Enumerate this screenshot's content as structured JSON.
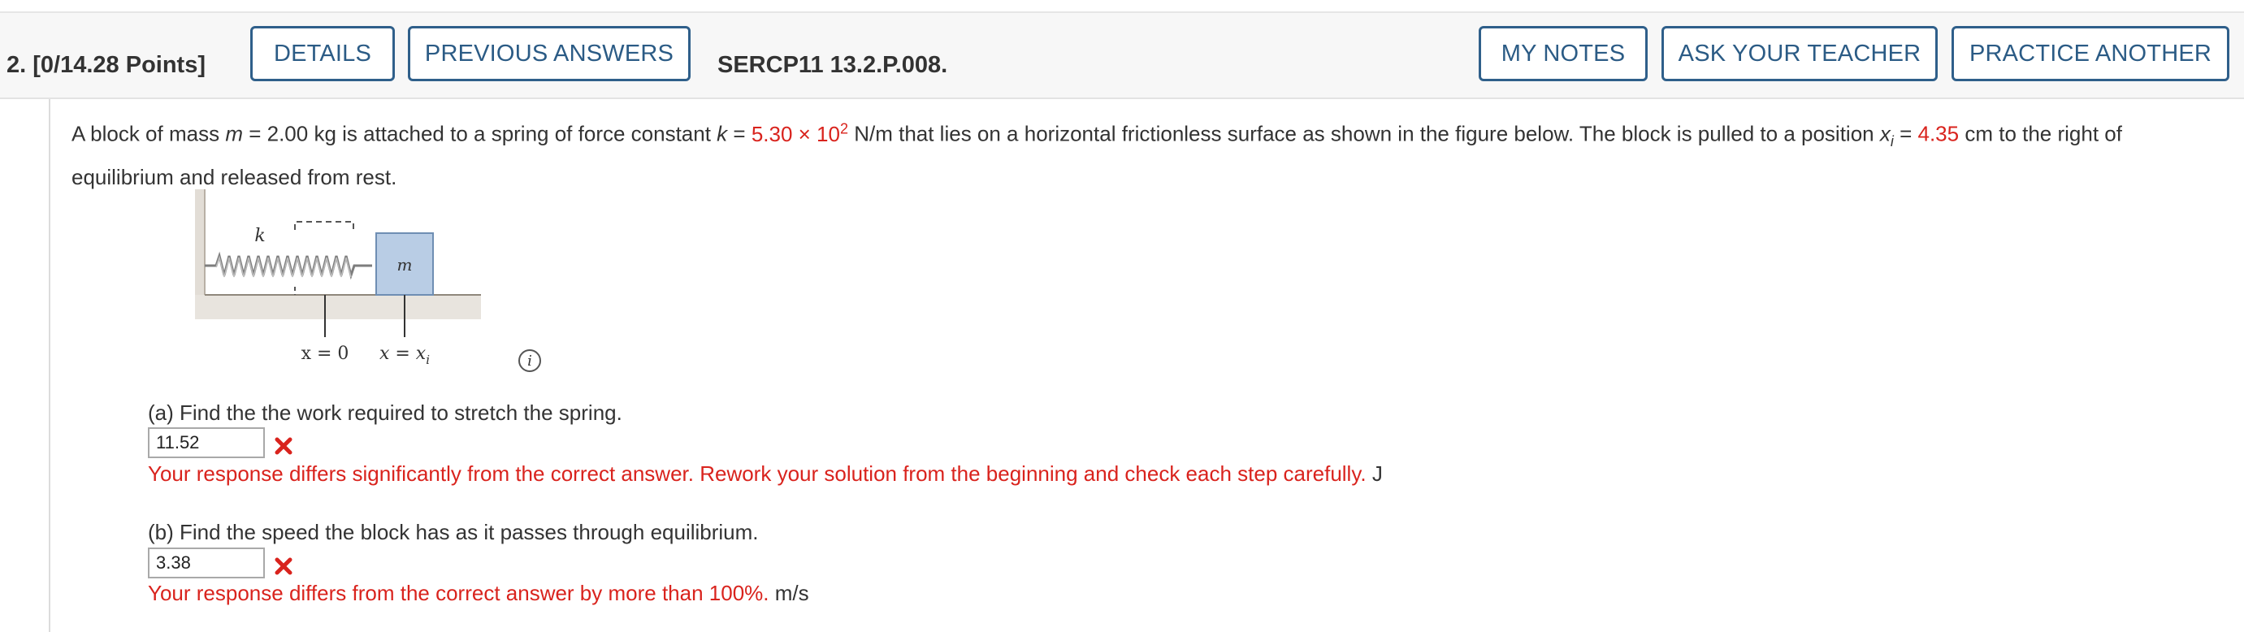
{
  "header": {
    "question_number": "2.",
    "points": "[0/14.28 Points]",
    "details_label": "DETAILS",
    "previous_answers_label": "PREVIOUS ANSWERS",
    "problem_code": "SERCP11 13.2.P.008.",
    "my_notes_label": "MY NOTES",
    "ask_teacher_label": "ASK YOUR TEACHER",
    "practice_another_label": "PRACTICE ANOTHER"
  },
  "question": {
    "t1": "A block of mass ",
    "m_var": "m",
    "t2": " = 2.00 kg is attached to a spring of force constant ",
    "k_var": "k",
    "t3": " = ",
    "k_value": "5.30 × 10",
    "k_exp": "2",
    "t4": " N/m that lies on a horizontal frictionless surface as shown in the figure below. The block is pulled to a position ",
    "x_var": "x",
    "x_sub": "i",
    "t5": " = ",
    "x_value": "4.35",
    "t6": " cm to the right of equilibrium and released from rest."
  },
  "figure": {
    "spring_label": "k",
    "mass_label": "m",
    "origin_label": "x = 0",
    "xi_label": "x = x",
    "xi_sub": "i",
    "info_icon": "info-icon"
  },
  "part_a": {
    "prompt": "(a) Find the the work required to stretch the spring.",
    "answer": "11.52",
    "feedback": "Your response differs significantly from the correct answer. Rework your solution from the beginning and check each step carefully.",
    "unit": "J"
  },
  "part_b": {
    "prompt": "(b) Find the speed the block has as it passes through equilibrium.",
    "answer": "3.38",
    "feedback": "Your response differs from the correct answer by more than 100%.",
    "unit": "m/s"
  },
  "colors": {
    "accent_blue": "#2b5b85",
    "error_red": "#d9231d",
    "block_fill": "#b9cde5"
  }
}
